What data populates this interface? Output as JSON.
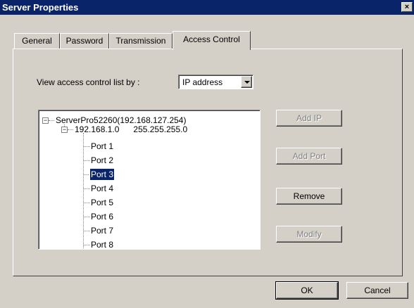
{
  "window": {
    "title": "Server Properties",
    "close_glyph": "×"
  },
  "tabs": [
    {
      "label": "General"
    },
    {
      "label": "Password"
    },
    {
      "label": "Transmission"
    },
    {
      "label": "Access Control",
      "active": true
    }
  ],
  "view_by": {
    "label": "View access control list by :",
    "selected": "IP address"
  },
  "tree": {
    "root": "ServerPro52260(192.168.127.254)",
    "subnet": "192.168.1.0      255.255.255.0",
    "ports": [
      "Port 1",
      "Port 2",
      "Port 3",
      "Port 4",
      "Port 5",
      "Port 6",
      "Port 7",
      "Port 8"
    ],
    "selected_port": "Port 3",
    "expander_glyph": "−"
  },
  "side_buttons": {
    "add_ip": "Add IP",
    "add_port": "Add Port",
    "remove": "Remove",
    "modify": "Modify"
  },
  "footer": {
    "ok": "OK",
    "cancel": "Cancel"
  },
  "colors": {
    "titlebar": "#0a246a",
    "face": "#d4d0c8",
    "selection": "#0a246a"
  }
}
